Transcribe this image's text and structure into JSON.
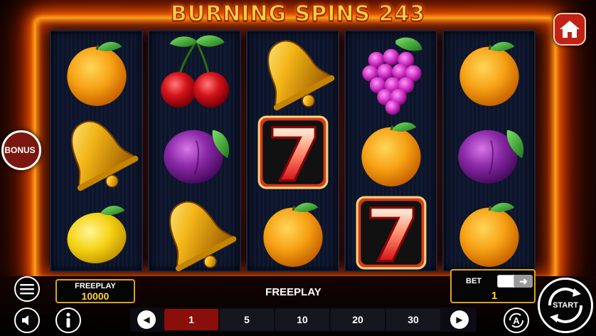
{
  "game": {
    "title": "BURNING SPINS 243"
  },
  "reels": [
    [
      "orange",
      "bell",
      "lemon"
    ],
    [
      "cherry",
      "plum",
      "bell"
    ],
    [
      "bell",
      "seven",
      "orange"
    ],
    [
      "grapes",
      "orange",
      "seven"
    ],
    [
      "orange",
      "plum",
      "orange"
    ]
  ],
  "side_buttons": {
    "home_icon": "home-icon",
    "bonus_label": "BONUS"
  },
  "balance": {
    "label": "FREEPLAY",
    "value": "10000"
  },
  "status_text": "FREEPLAY",
  "bet": {
    "label": "BET",
    "value": "1"
  },
  "lines": {
    "options": [
      "1",
      "5",
      "10",
      "20",
      "30"
    ],
    "selected": "1"
  },
  "controls": {
    "menu_icon": "menu-icon",
    "sound_icon": "speaker-icon",
    "info_icon": "info-icon",
    "auto_icon": "autoplay-icon",
    "start_label": "START"
  },
  "colors": {
    "title_gold": "#ffd23a",
    "fire": "#ff6a00",
    "panel_border": "#d9a321",
    "active_line": "#8a0f0b",
    "home_red": "#c12215"
  }
}
